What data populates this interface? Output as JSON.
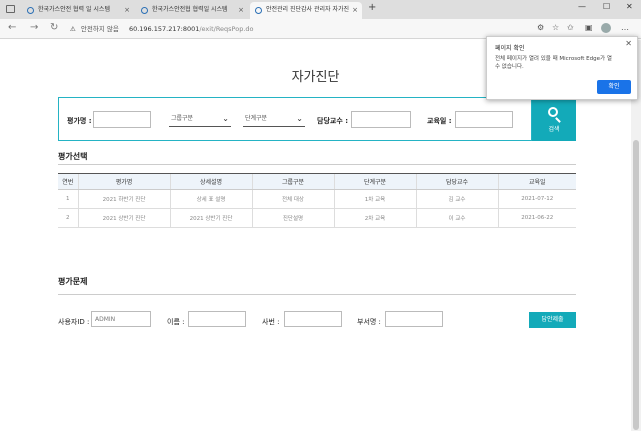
{
  "browser": {
    "tabs": [
      {
        "label": "한국가스안전 협력 일 시스템",
        "active": false
      },
      {
        "label": "한국가스안전협 협력일 시스템",
        "active": false
      },
      {
        "label": "안전관리 진단감사 관리자 자가진",
        "active": true
      }
    ],
    "address": {
      "security_label": "안전하지 않음",
      "host": "60.196.157.217:8001",
      "path": "/exit/ReqsPop.do"
    }
  },
  "page": {
    "title": "자가진단",
    "search": {
      "eval_name_label": "평가명 :",
      "eval_name_value": "",
      "group_select": "그룹구분",
      "stage_select": "단계구분",
      "professor_label": "담당교수 :",
      "professor_value": "",
      "date_label": "교육일 :",
      "date_value": "",
      "button_label": "검색"
    },
    "eval_select": {
      "section_title": "평가선택",
      "columns": [
        "연번",
        "평가명",
        "상세설명",
        "그룹구분",
        "단계구분",
        "담당교수",
        "교육일"
      ],
      "rows": [
        [
          "1",
          "2021 하반기 진단",
          "상세 표 설명",
          "전체 대상",
          "1차 교육",
          "김 교수",
          "2021-07-12"
        ],
        [
          "2",
          "2021 상반기 진단",
          "2021 상반기 진단",
          "진단설명",
          "2차 교육",
          "이 교수",
          "2021-06-22"
        ]
      ]
    },
    "eval_question": {
      "section_title": "평가문제",
      "user_id_label": "사용자ID :",
      "user_id_value": "ADMIN",
      "name_label": "이름 :",
      "name_value": "",
      "emp_no_label": "사번 :",
      "emp_no_value": "",
      "dept_label": "부서명 :",
      "dept_value": "",
      "submit_label": "답안제출"
    }
  },
  "popup": {
    "title": "페이지 확인",
    "message": "전체 페이지가 열려 있을 때 Microsoft Edge가 열 수 없습니다.",
    "button_label": "확인"
  },
  "colors": {
    "accent": "#13aab9",
    "border_accent": "#24b3c4",
    "popup_button": "#1a73e8"
  }
}
